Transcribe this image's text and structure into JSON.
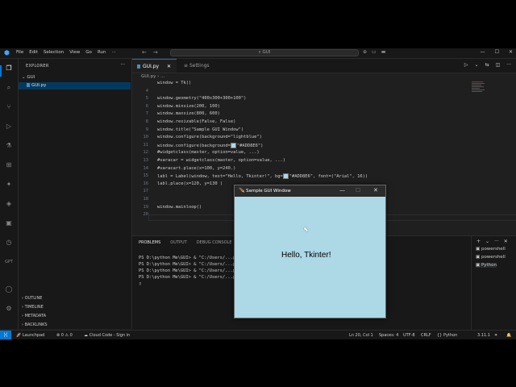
{
  "menu": [
    "File",
    "Edit",
    "Selection",
    "View",
    "Go",
    "Run"
  ],
  "command_center": {
    "text": "GUI"
  },
  "explorer": {
    "header": "EXPLORER",
    "folder": "GUI",
    "file": "GUI.py",
    "sections": [
      "OUTLINE",
      "TIMELINE",
      "METADATA",
      "BACKLINKS"
    ]
  },
  "tabs": [
    {
      "label": "GUI.py",
      "close": "✕"
    },
    {
      "label": "Settings"
    }
  ],
  "breadcrumb": "GUI.py › ...",
  "code_lines": [
    {
      "n": "",
      "text": "window = Tk()"
    },
    {
      "n": "4",
      "text": ""
    },
    {
      "n": "5",
      "text": "window.geometry(\"400x300+300+100\")"
    },
    {
      "n": "6",
      "text": "window.minsize(200, 100)"
    },
    {
      "n": "7",
      "text": "window.maxsize(800, 600)"
    },
    {
      "n": "8",
      "text": "window.resizable(False, False)"
    },
    {
      "n": "9",
      "text": "window.title(\"Sample GUI Window\")"
    },
    {
      "n": "10",
      "text": "window.configure(background=\"lightblue\")"
    },
    {
      "n": "11",
      "text": "window.configure(background=\"#ADD8E6\")"
    },
    {
      "n": "12",
      "text": "#widgetclass(master, option=value, ...)"
    },
    {
      "n": "13",
      "text": "#varacar = widgetclass(master, option=value, ...)"
    },
    {
      "n": "14",
      "text": "#varacart.place(x=100, y=240.)"
    },
    {
      "n": "15",
      "text": "labl = Label(window, text=\"Hello, Tkinter!\", bg=\"#ADD8E6\", font=(\"Arial\", 16))"
    },
    {
      "n": "16",
      "text": "labl.place(x=120, y=130 )"
    },
    {
      "n": "17",
      "text": ""
    },
    {
      "n": "18",
      "text": ""
    },
    {
      "n": "19",
      "text": "window.mainloop()"
    },
    {
      "n": "20",
      "text": ""
    }
  ],
  "panel": {
    "tabs": [
      "PROBLEMS",
      "OUTPUT",
      "DEBUG CONSOLE"
    ],
    "terminal_lines": [
      "PS D:\\python Me\\GUI> & \"C:/Users/...python.exe\" \"d:/python Me/GUI/GUI.py\"",
      "PS D:\\python Me\\GUI> & \"C:/Users/...python.exe\" \"d:/python Me/GUI/GUI.py\"",
      "PS D:\\python Me\\GUI> & \"C:/Users/...python.exe\" \"d:/python Me/GUI/GUI.py\"",
      "PS D:\\python Me\\GUI> & \"C:/Users/...python.exe\" \"d:/python Me/GUI/GUI.py\""
    ],
    "terminals": [
      "powershell",
      "powershell",
      "Python"
    ]
  },
  "status": {
    "launchpad": "Launchpad",
    "errors": "0",
    "warnings": "0",
    "cloud": "Cloud Code - Sign in",
    "position": "Ln 20, Col 1",
    "spaces": "Spaces: 4",
    "encoding": "UTF-8",
    "eol": "CRLF",
    "language": "Python",
    "version": "3.11.1"
  },
  "tk_window": {
    "title": "Sample GUI Window",
    "label": "Hello, Tkinter!",
    "background": "#ADD8E6"
  },
  "colors": {
    "accent": "#0078d4",
    "editor_bg": "#1f1f1f"
  }
}
